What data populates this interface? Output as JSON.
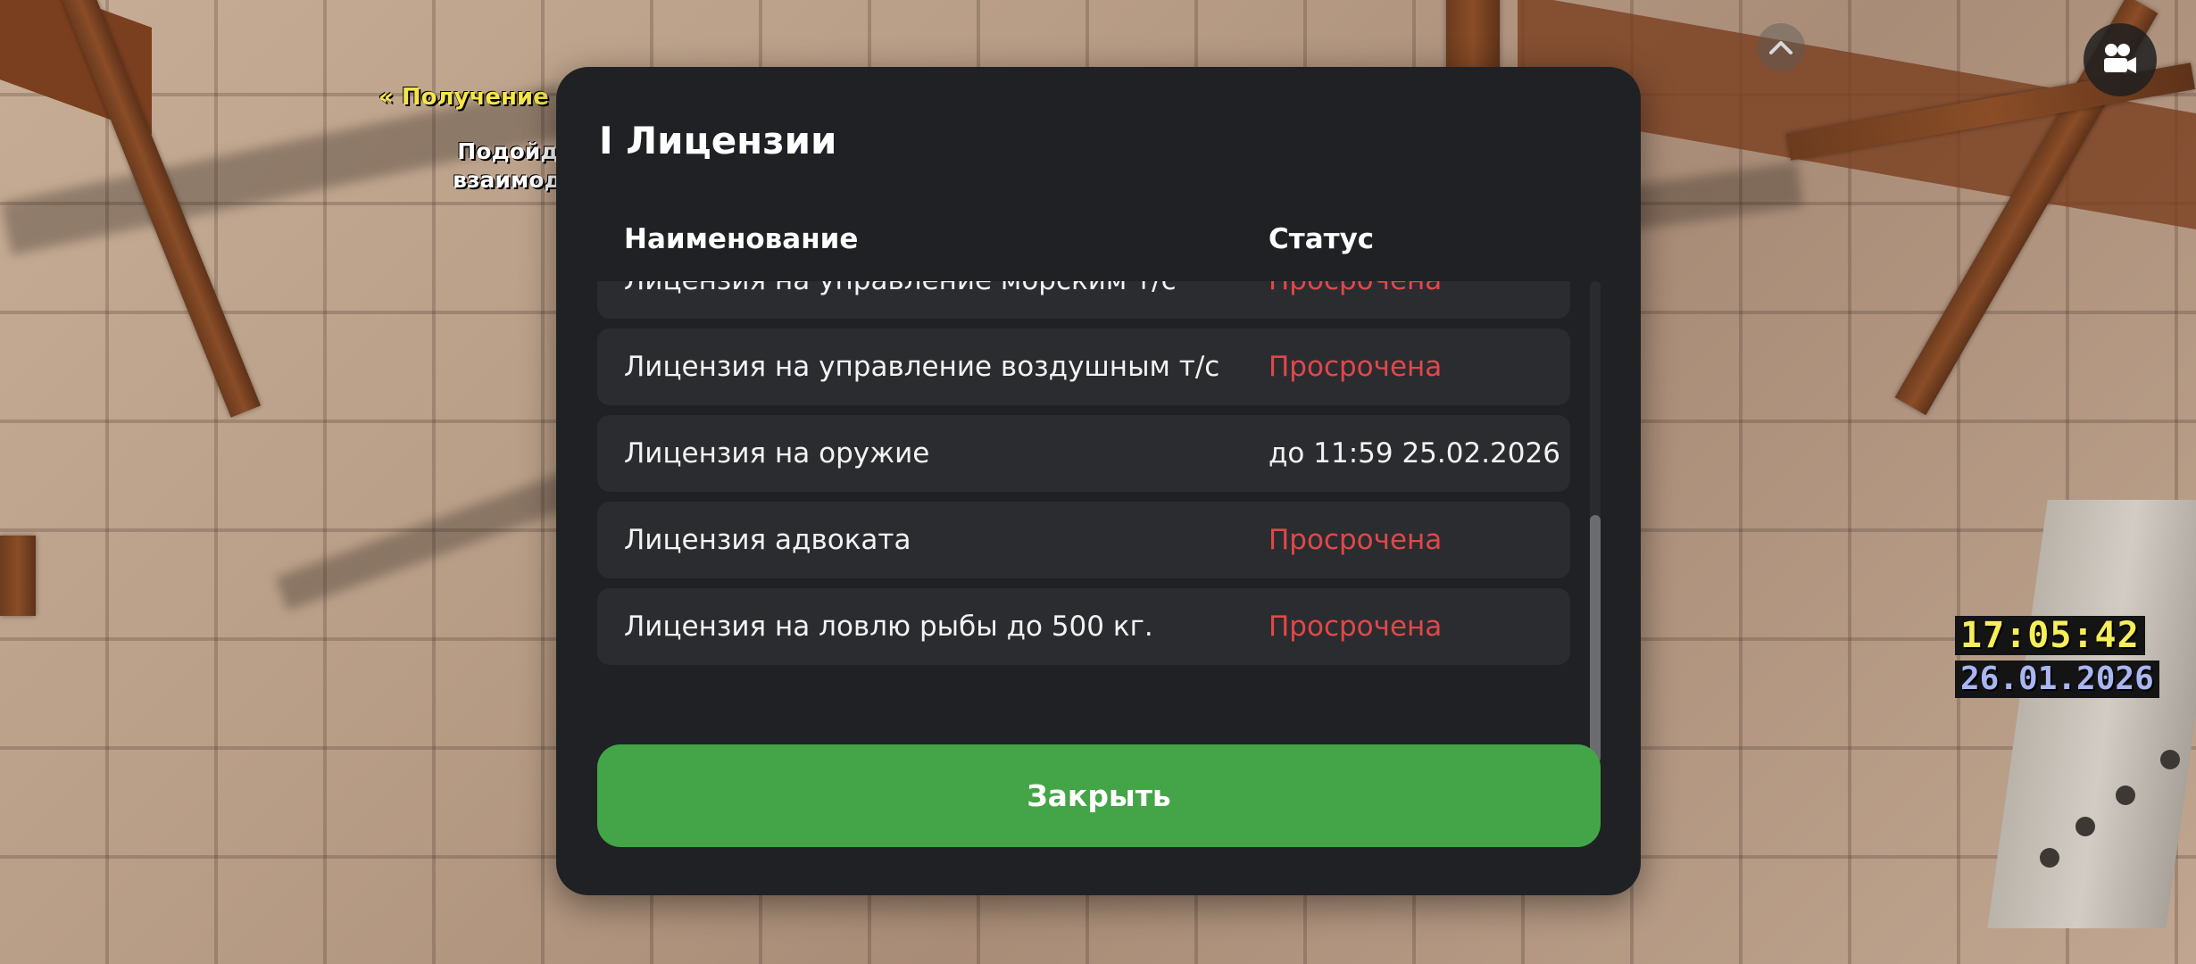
{
  "world": {
    "quest_text": "« Получение мед карты",
    "hint_text": "Подойдите для взаимодействия"
  },
  "hud": {
    "time": "17:05:42",
    "date": "26.01.2026",
    "up_icon": "chevron-up-icon",
    "camera_icon": "video-camera-icon"
  },
  "modal": {
    "title": "I Лицензии",
    "columns": {
      "name": "Наименование",
      "status": "Статус"
    },
    "rows": [
      {
        "name": "Лицензия на управление морским т/с",
        "status": "Просрочена",
        "expired": true
      },
      {
        "name": "Лицензия на управление воздушным т/с",
        "status": "Просрочена",
        "expired": true
      },
      {
        "name": "Лицензия на оружие",
        "status": "до 11:59 25.02.2026",
        "expired": false
      },
      {
        "name": "Лицензия адвоката",
        "status": "Просрочена",
        "expired": true
      },
      {
        "name": "Лицензия на ловлю рыбы до 500 кг.",
        "status": "Просрочена",
        "expired": true
      }
    ],
    "close_label": "Закрыть"
  },
  "colors": {
    "expired": "#e0484a",
    "valid": "#f2f2f2",
    "close_button": "#43a547",
    "modal_bg": "#202124",
    "row_bg": "#2b2c30"
  }
}
